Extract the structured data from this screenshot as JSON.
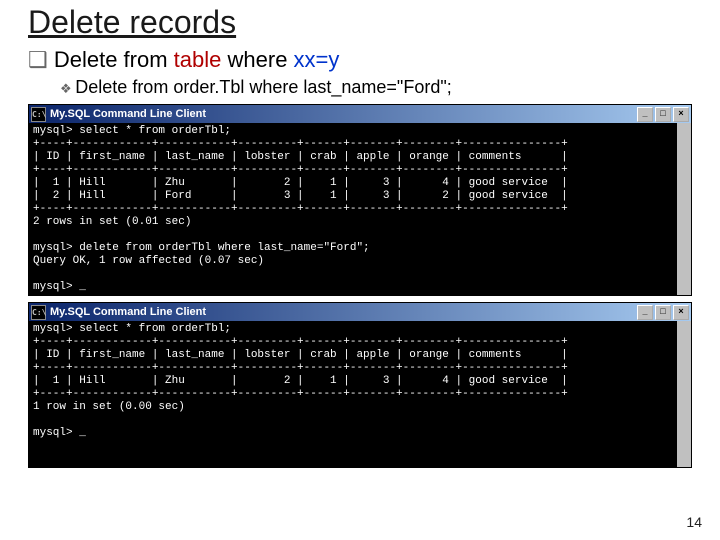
{
  "title": "Delete records",
  "bullets": {
    "level1": {
      "pre1": "Delete from ",
      "kw1": "table",
      "mid": " where ",
      "kw2": "xx=y"
    },
    "level2": "Delete from order.Tbl where last_name=\"Ford\";"
  },
  "window": {
    "title": "My.SQL Command Line Client",
    "min": "_",
    "max": "□",
    "close": "×",
    "icon": "C:\\"
  },
  "console1": "mysql> select * from orderTbl;\n+----+------------+-----------+---------+------+-------+--------+---------------+\n| ID | first_name | last_name | lobster | crab | apple | orange | comments      |\n+----+------------+-----------+---------+------+-------+--------+---------------+\n|  1 | Hill       | Zhu       |       2 |    1 |     3 |      4 | good service  |\n|  2 | Hill       | Ford      |       3 |    1 |     3 |      2 | good service  |\n+----+------------+-----------+---------+------+-------+--------+---------------+\n2 rows in set (0.01 sec)\n\nmysql> delete from orderTbl where last_name=\"Ford\";\nQuery OK, 1 row affected (0.07 sec)\n\nmysql> _",
  "console2": "mysql> select * from orderTbl;\n+----+------------+-----------+---------+------+-------+--------+---------------+\n| ID | first_name | last_name | lobster | crab | apple | orange | comments      |\n+----+------------+-----------+---------+------+-------+--------+---------------+\n|  1 | Hill       | Zhu       |       2 |    1 |     3 |      4 | good service  |\n+----+------------+-----------+---------+------+-------+--------+---------------+\n1 row in set (0.00 sec)\n\nmysql> _",
  "chart_data": {
    "type": "table",
    "columns": [
      "ID",
      "first_name",
      "last_name",
      "lobster",
      "crab",
      "apple",
      "orange",
      "comments"
    ],
    "before_delete": [
      [
        1,
        "Hill",
        "Zhu",
        2,
        1,
        3,
        4,
        "good service"
      ],
      [
        2,
        "Hill",
        "Ford",
        3,
        1,
        3,
        2,
        "good service"
      ]
    ],
    "after_delete": [
      [
        1,
        "Hill",
        "Zhu",
        2,
        1,
        3,
        4,
        "good service"
      ]
    ],
    "delete_statement": "delete from orderTbl where last_name=\"Ford\";",
    "rows_affected": 1
  },
  "page_number": "14"
}
